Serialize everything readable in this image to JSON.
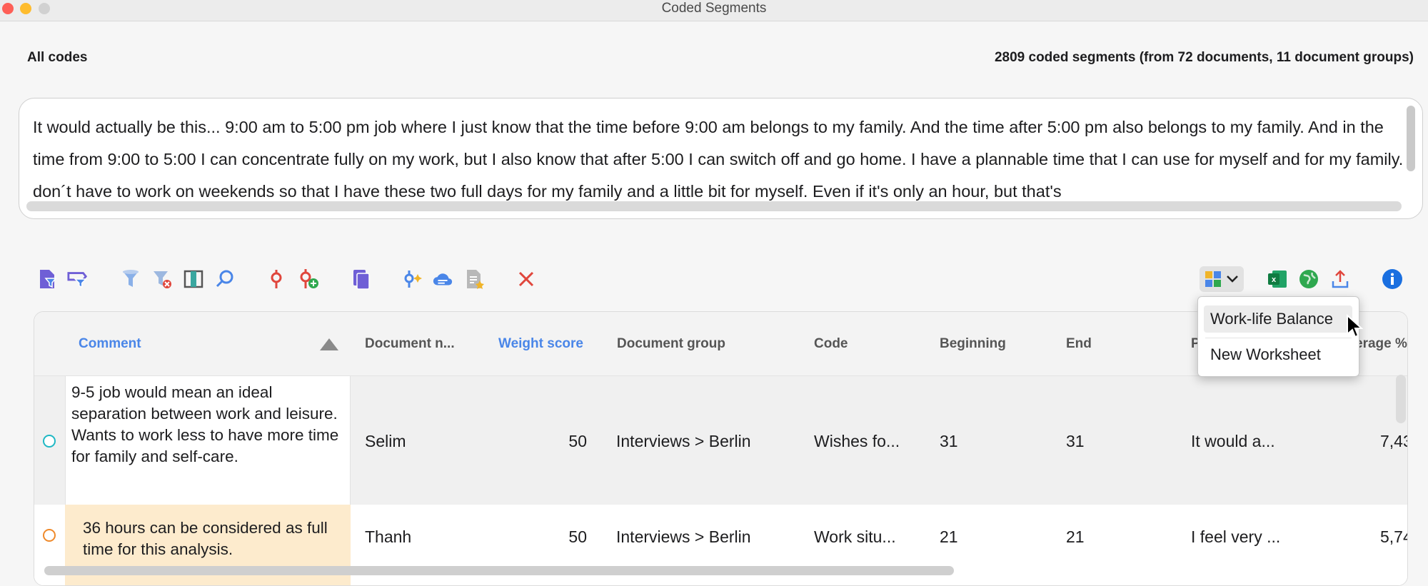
{
  "window": {
    "title": "Coded Segments"
  },
  "header": {
    "filter_label": "All codes",
    "segment_count": "2809 coded segments (from 72 documents, 11 document groups)"
  },
  "preview": {
    "text": "It would actually be this... 9:00 am to 5:00 pm job where I just know that the time before 9:00 am belongs to my family. And the time after 5:00 pm also belongs to my family. And in the time from 9:00 to 5:00 I can concentrate fully on my work, but I also know that after 5:00 I can switch off and go home. I have a plannable time that I can use for myself and for my family. I don´t have to work on weekends so that I have these two full days for my family and a little bit for myself. Even if it's only an hour, but that's"
  },
  "toolbar": {
    "icons": [
      "document-filter-icon",
      "code-filter-icon",
      "filter-icon",
      "clear-filter-icon",
      "columns-icon",
      "search-icon",
      "code-icon",
      "add-code-icon",
      "copy-documents-icon",
      "ai-assist-icon",
      "cloud-comment-icon",
      "summary-icon",
      "delete-icon",
      "worksheet-icon",
      "excel-icon",
      "web-export-icon",
      "export-icon",
      "info-icon"
    ]
  },
  "table": {
    "columns": {
      "comment": "Comment",
      "document_name": "Document n...",
      "weight_score": "Weight score",
      "document_group": "Document group",
      "code": "Code",
      "beginning": "Beginning",
      "end": "End",
      "preview": "P",
      "coverage": "erage %"
    },
    "rows": [
      {
        "comment": "9-5 job would mean an ideal separation between work and leisure. Wants to work less to have more time for family and self-care.",
        "document_name": "Selim",
        "weight_score": "50",
        "document_group": "Interviews > Berlin",
        "code": "Wishes fo...",
        "beginning": "31",
        "end": "31",
        "preview": "It would a...",
        "coverage": "7,43"
      },
      {
        "comment": "36 hours can be considered as full time for this analysis.",
        "document_name": "Thanh",
        "weight_score": "50",
        "document_group": "Interviews > Berlin",
        "code": "Work situ...",
        "beginning": "21",
        "end": "21",
        "preview": "I feel very ...",
        "coverage": "5,74"
      }
    ],
    "row_colors": [
      "#1fb8c4",
      "#ef8a2b"
    ]
  },
  "dropdown": {
    "items": [
      "Work-life Balance",
      "New Worksheet"
    ]
  },
  "colors": {
    "accent_blue": "#4a86e8",
    "comment_highlight": "#fdebcd",
    "delete_red": "#e0463c"
  }
}
